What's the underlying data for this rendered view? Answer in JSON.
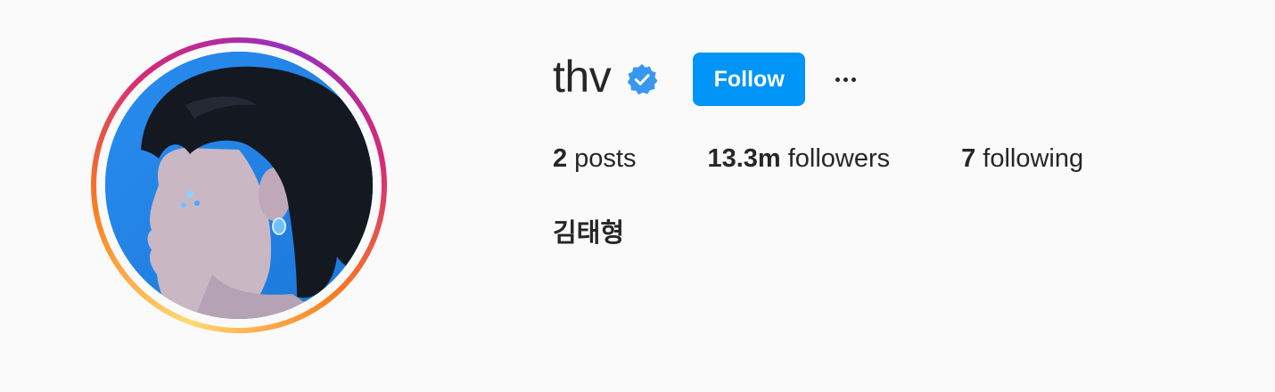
{
  "profile": {
    "username": "thv",
    "full_name": "김태형",
    "verified": true,
    "follow_label": "Follow",
    "more_icon": "more-horizontal-icon"
  },
  "stats": [
    {
      "value": "2",
      "label": "posts"
    },
    {
      "value": "13.3m",
      "label": "followers"
    },
    {
      "value": "7",
      "label": "following"
    }
  ],
  "colors": {
    "accent": "#0095f6",
    "verified_badge": "#3897f0",
    "text": "#262626",
    "background": "#fafafa",
    "story_ring": [
      "#feda75",
      "#fa7e1e",
      "#d62976",
      "#962fbf"
    ]
  }
}
